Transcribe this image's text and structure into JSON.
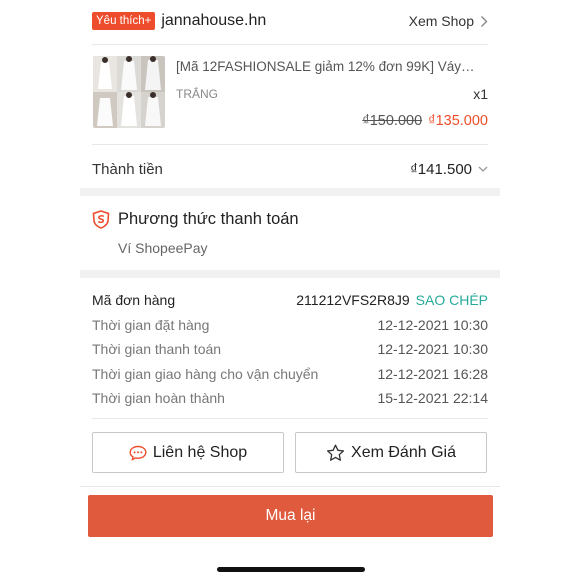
{
  "shop": {
    "badge": "Yêu thích+",
    "name": "jannahouse.hn",
    "view_shop": "Xem Shop"
  },
  "product": {
    "title": "[Mã 12FASHIONSALE giảm 12% đơn 99K] Váy…",
    "variation": "TRẮNG",
    "quantity": "x1",
    "old_price": "₫150.000",
    "new_price": "₫135.000"
  },
  "total": {
    "label": "Thành tiền",
    "value": "₫141.500"
  },
  "payment": {
    "title": "Phương thức thanh toán",
    "method": "Ví ShopeePay"
  },
  "order": {
    "id_label": "Mã đơn hàng",
    "id_value": "211212VFS2R8J9",
    "copy": "SAO CHÉP",
    "rows": [
      {
        "label": "Thời gian đặt hàng",
        "value": "12-12-2021 10:30"
      },
      {
        "label": "Thời gian thanh toán",
        "value": "12-12-2021 10:30"
      },
      {
        "label": "Thời gian giao hàng cho vận chuyển",
        "value": "12-12-2021 16:28"
      },
      {
        "label": "Thời gian hoàn thành",
        "value": "15-12-2021 22:14"
      }
    ]
  },
  "actions": {
    "contact_shop": "Liên hệ Shop",
    "view_rating": "Xem Đánh Giá",
    "buy_again": "Mua lại"
  },
  "colors": {
    "accent": "#ee4d2d",
    "copy": "#26aa99",
    "buy_again_bg": "#e05a3d"
  }
}
